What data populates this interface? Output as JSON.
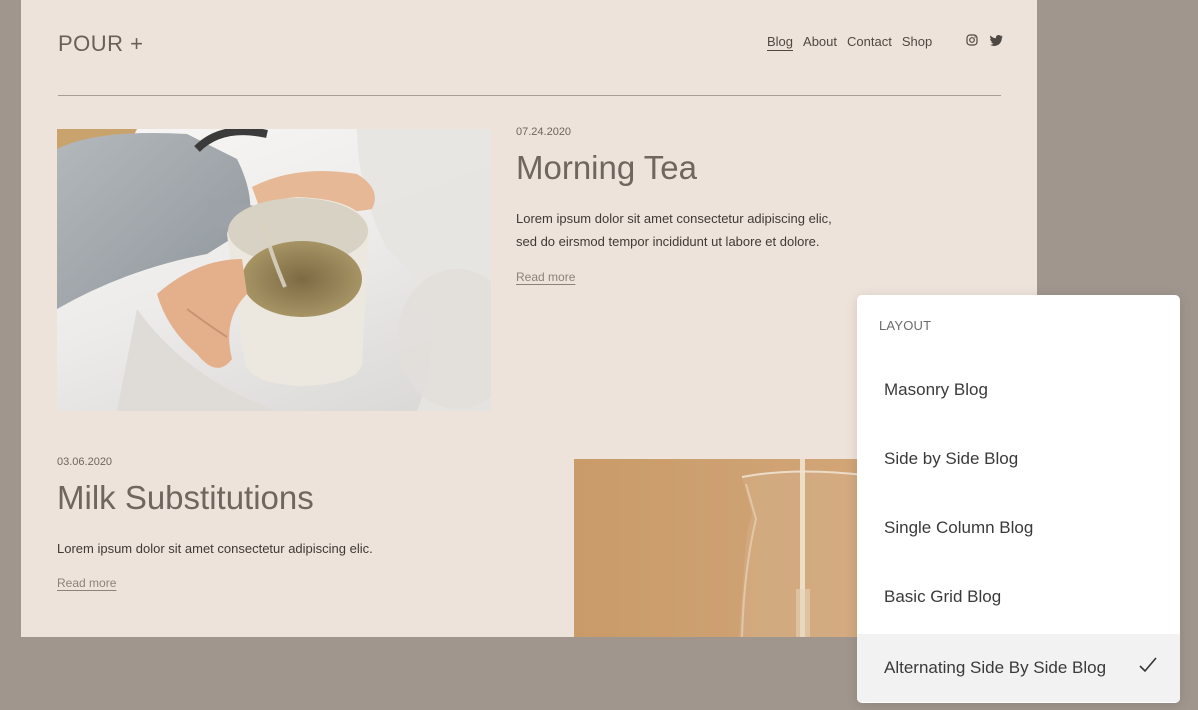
{
  "site": {
    "logo": "POUR +",
    "nav": [
      "Blog",
      "About",
      "Contact",
      "Shop"
    ],
    "social_icons": [
      "instagram-icon",
      "twitter-icon"
    ]
  },
  "posts": [
    {
      "date": "07.24.2020",
      "title": "Morning Tea",
      "excerpt_lines": [
        "Lorem ipsum dolor sit amet consectetur adipiscing elic,",
        "sed do eirsmod tempor incididunt ut labore et dolore."
      ],
      "read_more": "Read more"
    },
    {
      "date": "03.06.2020",
      "title": "Milk Substitutions",
      "excerpt_lines": [
        "Lorem ipsum dolor sit amet consectetur adipiscing elic."
      ],
      "read_more": "Read more"
    }
  ],
  "layout_menu": {
    "header": "LAYOUT",
    "items": [
      "Masonry Blog",
      "Side by Side Blog",
      "Single Column Blog",
      "Basic Grid Blog",
      "Alternating Side By Side Blog"
    ],
    "selected": "Alternating Side By Side Blog"
  },
  "colors": {
    "page_bg": "#eee3da",
    "backdrop": "#a0968d",
    "title": "#6e665f"
  }
}
